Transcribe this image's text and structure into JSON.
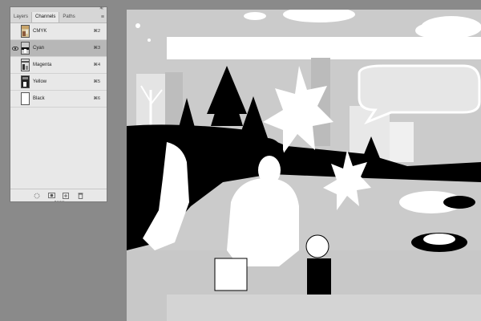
{
  "panel": {
    "tabs": [
      {
        "label": "Layers"
      },
      {
        "label": "Channels"
      },
      {
        "label": "Paths"
      }
    ],
    "active_tab": "Channels",
    "collapse_glyph": "«",
    "close_glyph": "×",
    "menu_glyph": "≡",
    "channels": [
      {
        "name": "CMYK",
        "shortcut": "⌘2",
        "visible": false,
        "selected": false,
        "thumb": "color"
      },
      {
        "name": "Cyan",
        "shortcut": "⌘3",
        "visible": true,
        "selected": true,
        "thumb": "gray"
      },
      {
        "name": "Magenta",
        "shortcut": "⌘4",
        "visible": false,
        "selected": false,
        "thumb": "gray"
      },
      {
        "name": "Yellow",
        "shortcut": "⌘5",
        "visible": false,
        "selected": false,
        "thumb": "dark"
      },
      {
        "name": "Black",
        "shortcut": "⌘6",
        "visible": false,
        "selected": false,
        "thumb": "white"
      }
    ],
    "footer_icons": [
      "dotted-circle-icon",
      "mask-icon",
      "new-channel-icon",
      "trash-icon"
    ]
  },
  "colors": {
    "workspace": "#8a8a8a",
    "canvas": "#cbcbcb",
    "panel": "#e8e8e8",
    "selected_row": "#b7b7b7"
  }
}
